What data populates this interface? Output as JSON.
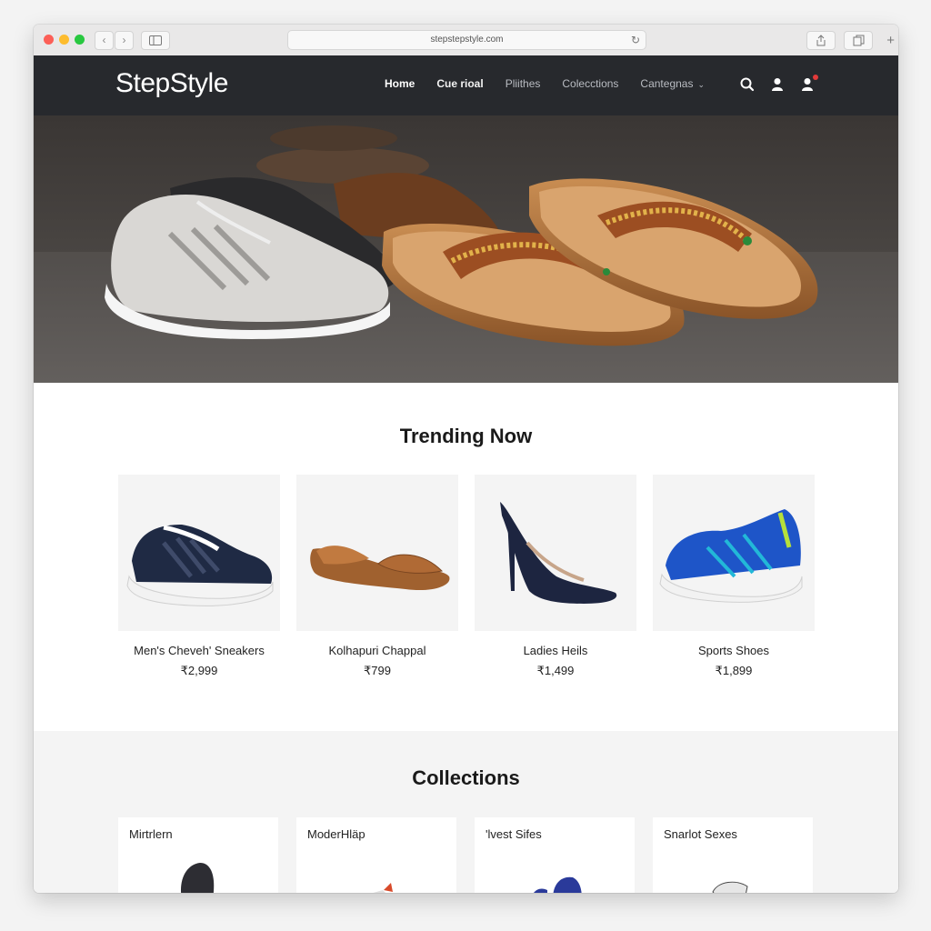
{
  "browser": {
    "url": "stepstepstyle.com",
    "back_glyph": "‹",
    "forward_glyph": "›",
    "reload_glyph": "↻",
    "new_tab_glyph": "+"
  },
  "site": {
    "logo": "StepStyle",
    "nav": [
      {
        "label": "Home"
      },
      {
        "label": "Cue rioal"
      },
      {
        "label": "Pliithes"
      },
      {
        "label": "Colecctions"
      },
      {
        "label": "Cantegnas"
      }
    ],
    "nav_chevron": "⌄",
    "icons": [
      "search-icon",
      "user-icon",
      "notification-icon"
    ]
  },
  "trending": {
    "title": "Trending Now",
    "products": [
      {
        "name": "Men's Cheveh' Sneakers",
        "price": "₹2,999"
      },
      {
        "name": "Kolhapuri Chappal",
        "price": "₹799"
      },
      {
        "name": "Ladies Heils",
        "price": "₹1,499"
      },
      {
        "name": "Sports Shoes",
        "price": "₹1,899"
      }
    ]
  },
  "collections": {
    "title": "Collections",
    "items": [
      {
        "label": "Mirtrlern"
      },
      {
        "label": "ModerHläp"
      },
      {
        "label": "'lvest Sifes"
      },
      {
        "label": "Snarlot Sexes"
      }
    ]
  },
  "colors": {
    "header_bg": "#27292d",
    "page_bg": "#ffffff",
    "band_bg": "#f4f4f4"
  }
}
